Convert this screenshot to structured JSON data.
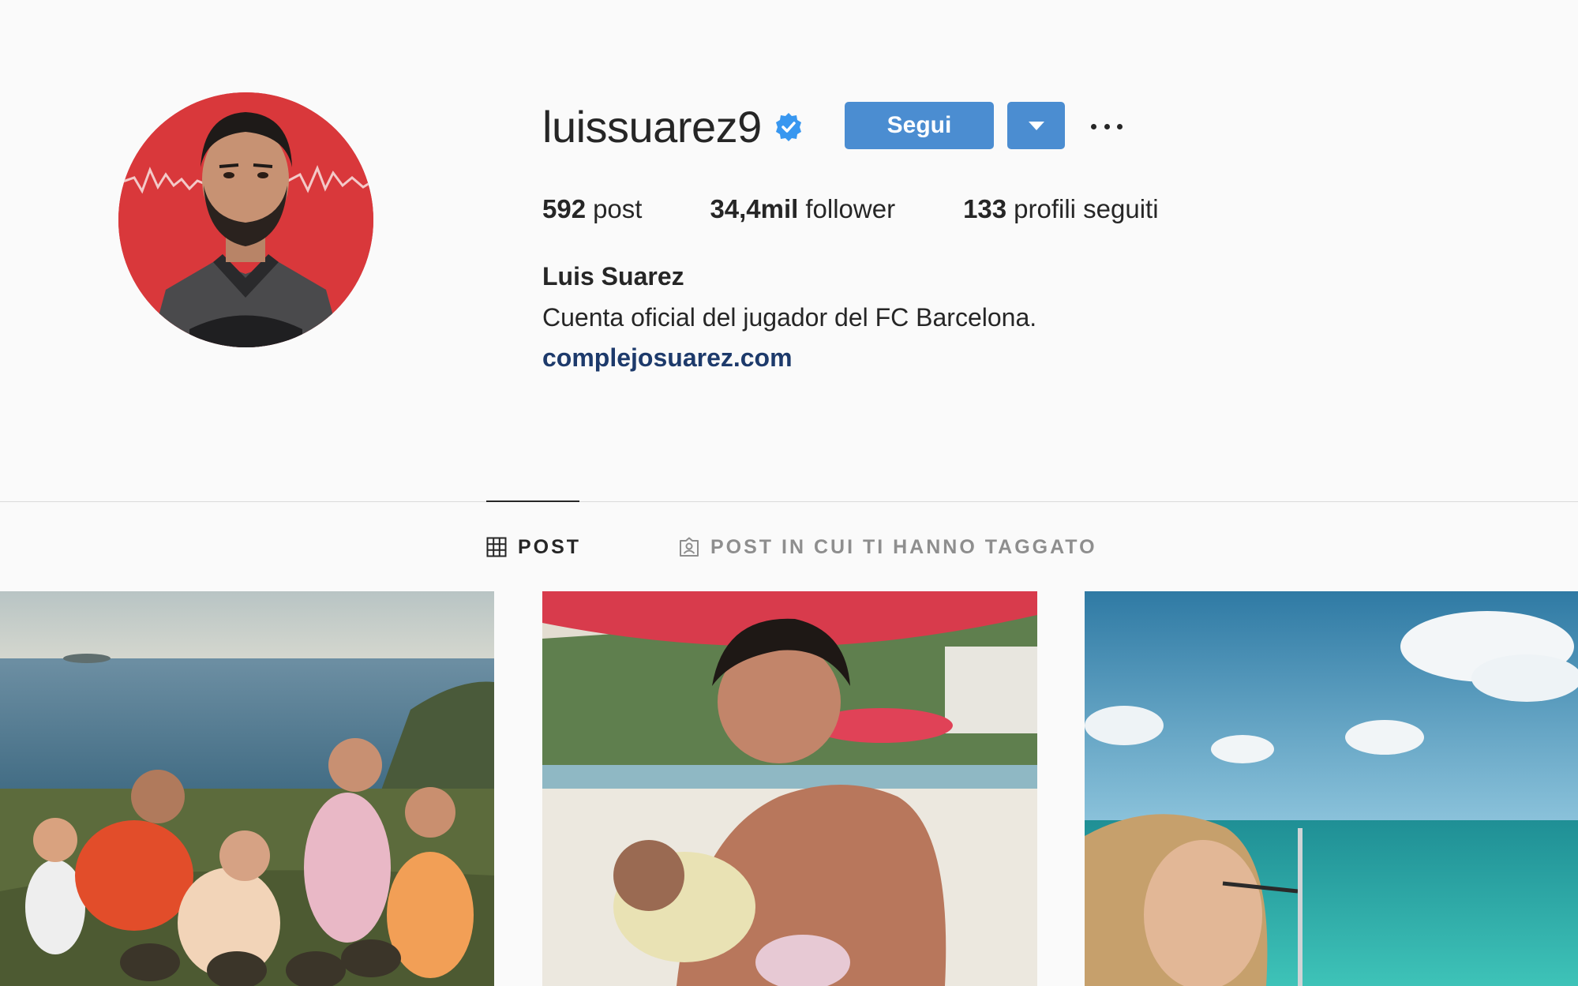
{
  "profile": {
    "username": "luissuarez9",
    "verified": true,
    "follow_label": "Segui",
    "stats": [
      {
        "count": "592",
        "label": "post"
      },
      {
        "count": "34,4mil",
        "label": "follower"
      },
      {
        "count": "133",
        "label": "profili seguiti"
      }
    ],
    "full_name": "Luis Suarez",
    "bio": "Cuenta oficial del jugador del FC Barcelona.",
    "website": "complejosuarez.com"
  },
  "tabs": [
    {
      "label": "POST",
      "icon": "grid-icon",
      "active": true
    },
    {
      "label": "POST IN CUI TI HANNO TAGGATO",
      "icon": "tagged-user-icon",
      "active": false
    }
  ],
  "posts": [
    {
      "scene": "family-group-on-hillside-by-sea"
    },
    {
      "scene": "man-holding-baby-on-beach"
    },
    {
      "scene": "woman-on-boat-turquoise-sea"
    }
  ],
  "colors": {
    "accent": "#4b8dd1",
    "verified_badge": "#3897f0",
    "link": "#1d3a6b",
    "text": "#262626",
    "muted": "#8e8e8e",
    "background": "#fafafa",
    "divider": "#dbdbdb"
  }
}
